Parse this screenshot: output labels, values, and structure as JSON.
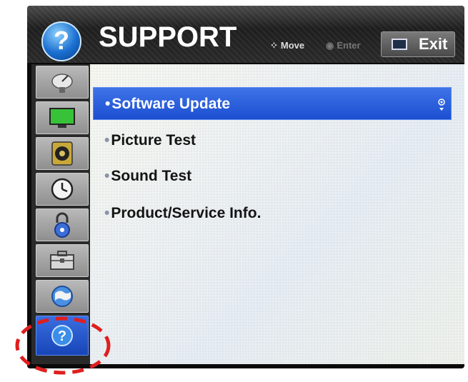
{
  "header": {
    "title": "SUPPORT",
    "move_label": "Move",
    "enter_label": "Enter",
    "exit_label": "Exit",
    "help_symbol": "?"
  },
  "sidebar": {
    "items": [
      {
        "icon": "satellite-dish-icon",
        "active": false
      },
      {
        "icon": "monitor-icon",
        "active": false
      },
      {
        "icon": "speaker-icon",
        "active": false
      },
      {
        "icon": "clock-icon",
        "active": false
      },
      {
        "icon": "lock-icon",
        "active": false
      },
      {
        "icon": "toolbox-icon",
        "active": false
      },
      {
        "icon": "globe-icon",
        "active": false
      },
      {
        "icon": "help-icon",
        "active": true,
        "symbol": "?"
      }
    ]
  },
  "menu": {
    "items": [
      {
        "label": "Software Update",
        "selected": true
      },
      {
        "label": "Picture Test",
        "selected": false
      },
      {
        "label": "Sound Test",
        "selected": false
      },
      {
        "label": "Product/Service Info.",
        "selected": false
      }
    ],
    "bullet": "•"
  },
  "colors": {
    "selection": "#1b4fd0",
    "annotation": "#e01e1e",
    "header": "#1e1e1e"
  }
}
